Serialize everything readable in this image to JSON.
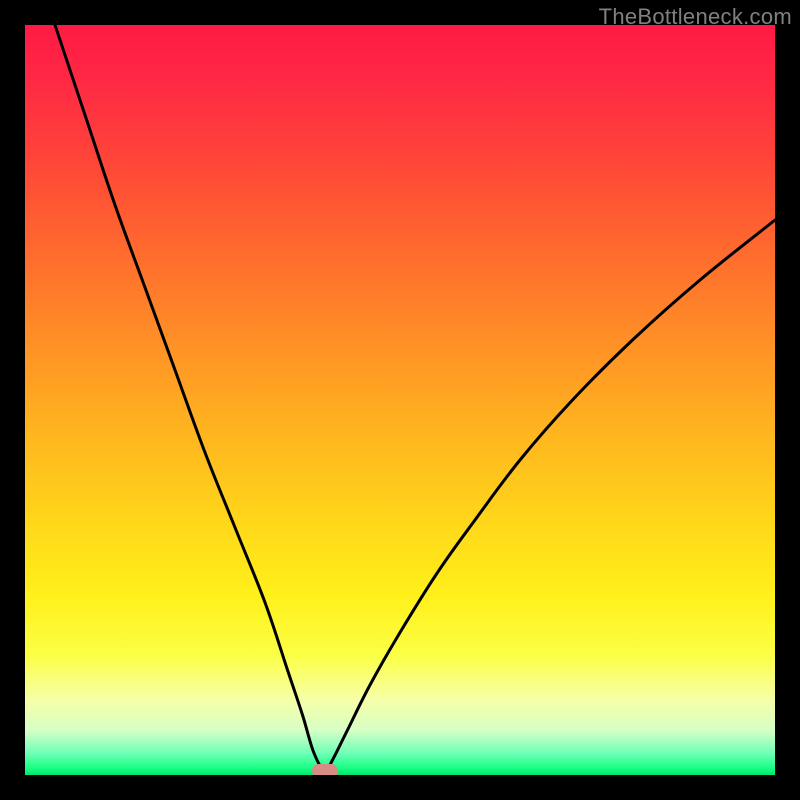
{
  "watermark": "TheBottleneck.com",
  "chart_data": {
    "type": "line",
    "title": "",
    "xlabel": "",
    "ylabel": "",
    "xlim": [
      0,
      100
    ],
    "ylim": [
      0,
      100
    ],
    "background_gradient": {
      "top_color": "#ff1a44",
      "mid_color": "#ffd61a",
      "bottom_color": "#00e56b"
    },
    "series": [
      {
        "name": "bottleneck-curve",
        "color": "#000000",
        "x": [
          4,
          8,
          12,
          16,
          20,
          24,
          28,
          32,
          35,
          37,
          38.5,
          40,
          41,
          43,
          46,
          50,
          55,
          60,
          66,
          73,
          81,
          90,
          100
        ],
        "y": [
          100,
          88,
          76,
          65,
          54,
          43,
          33,
          23,
          14,
          8,
          3,
          0.5,
          2,
          6,
          12,
          19,
          27,
          34,
          42,
          50,
          58,
          66,
          74
        ]
      }
    ],
    "marker": {
      "name": "optimal-point",
      "x": 40,
      "y": 0.5,
      "color": "#d98b86"
    }
  }
}
